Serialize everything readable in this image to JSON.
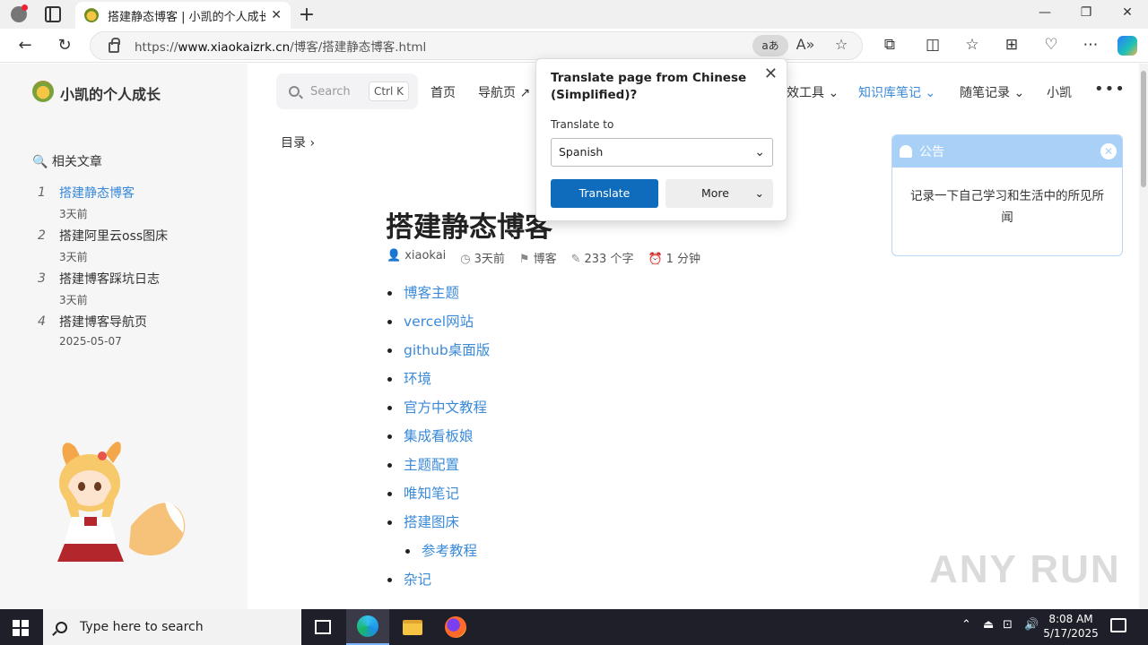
{
  "browser": {
    "tab_title": "搭建静态博客 | 小凯的个人成长",
    "url_prefix": "https://",
    "url_host": "www.xiaokaizrk.cn",
    "url_path": "/博客/搭建静态博客.html",
    "translate_pill": "aあ"
  },
  "site": {
    "name": "小凯的个人成长",
    "related_title": "相关文章",
    "related": [
      {
        "num": "1",
        "title": "搭建静态博客",
        "date": "3天前"
      },
      {
        "num": "2",
        "title": "搭建阿里云oss图床",
        "date": "3天前"
      },
      {
        "num": "3",
        "title": "搭建博客踩坑日志",
        "date": "3天前"
      },
      {
        "num": "4",
        "title": "搭建博客导航页",
        "date": "2025-05-07"
      }
    ]
  },
  "header": {
    "search_placeholder": "Search",
    "search_shortcut": "Ctrl K",
    "nav": [
      "首页",
      "导航页 ↗",
      "效工具",
      "知识库笔记",
      "随笔记录",
      "小凯"
    ],
    "more": "•••"
  },
  "article": {
    "toc_label": "目录",
    "title": "搭建静态博客",
    "author": "xiaokai",
    "time": "3天前",
    "category": "博客",
    "words": "233 个字",
    "read_time": "1 分钟",
    "toc": [
      {
        "text": "博客主题",
        "sub": false
      },
      {
        "text": "vercel网站",
        "sub": false
      },
      {
        "text": "github桌面版",
        "sub": false
      },
      {
        "text": "环境",
        "sub": false
      },
      {
        "text": "官方中文教程",
        "sub": false
      },
      {
        "text": "集成看板娘",
        "sub": false
      },
      {
        "text": "主题配置",
        "sub": false
      },
      {
        "text": "唯知笔记",
        "sub": false
      },
      {
        "text": "搭建图床",
        "sub": false
      },
      {
        "text": "参考教程",
        "sub": true
      },
      {
        "text": "杂记",
        "sub": false
      }
    ]
  },
  "notice": {
    "title": "公告",
    "body": "记录一下自己学习和生活中的所见所闻"
  },
  "translate_popup": {
    "title": "Translate page from Chinese (Simplified)?",
    "label": "Translate to",
    "selected": "Spanish",
    "translate_button": "Translate",
    "more_button": "More"
  },
  "taskbar": {
    "search_placeholder": "Type here to search",
    "time": "8:08 AM",
    "date": "5/17/2025"
  },
  "watermark": "ANY RUN",
  "colors": {
    "link": "#3a8ad8",
    "translate_button": "#0f6cbd",
    "notice_header": "#a9d0f7"
  }
}
